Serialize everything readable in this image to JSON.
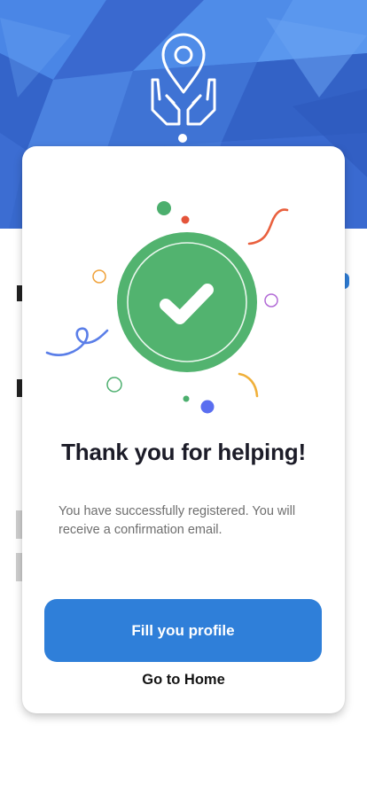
{
  "colors": {
    "hero_blue": "#3b6fd6",
    "primary_button": "#2f7fd9",
    "success_green": "#4caf6e"
  },
  "hero": {
    "logo_icon": "location-hands-icon"
  },
  "modal": {
    "illustration_icon": "check-circle-icon",
    "title": "Thank you for helping!",
    "message": "You have successfully registered. You will receive a confirmation email.",
    "primary_button_label": "Fill you profile",
    "secondary_link_label": "Go to Home"
  }
}
